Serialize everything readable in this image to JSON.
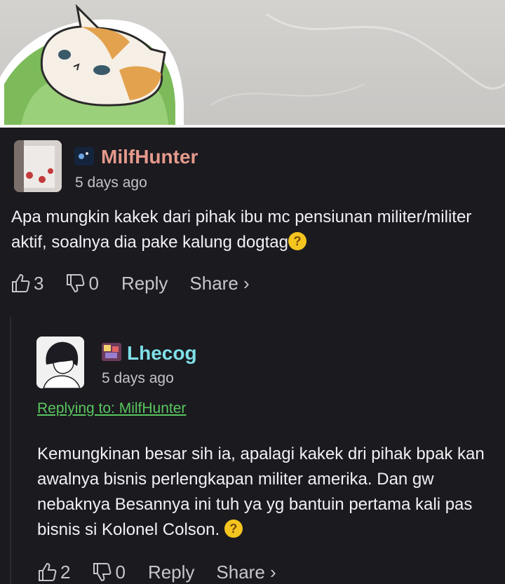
{
  "comments": [
    {
      "username": "MilfHunter",
      "time": "5 days ago",
      "body": "Apa mungkin kakek dari pihak ibu mc pensiunan militer/militer aktif, soalnya dia pake kalung dogtag",
      "likes": "3",
      "dislikes": "0",
      "reply_label": "Reply",
      "share_label": "Share ›",
      "username_color": "#e59a8c"
    },
    {
      "username": "Lhecog",
      "time": "5 days ago",
      "replying_to": "Replying to: MilfHunter",
      "body": "Kemungkinan besar sih ia, apalagi kakek dri pihak bpak kan awalnya bisnis perlengkapan militer amerika. Dan gw nebaknya Besannya ini tuh ya yg bantuin pertama kali pas bisnis si Kolonel Colson.",
      "likes": "2",
      "dislikes": "0",
      "reply_label": "Reply",
      "share_label": "Share ›",
      "username_color": "#7fe0e8"
    }
  ],
  "icons": {
    "banner": "cat-in-lettuce-illustration",
    "emoji": "thinking-face-emoji",
    "like": "thumbs-up-icon",
    "dislike": "thumbs-down-icon"
  },
  "colors": {
    "background": "#1b1a1f",
    "reply_link": "#59c65f"
  }
}
